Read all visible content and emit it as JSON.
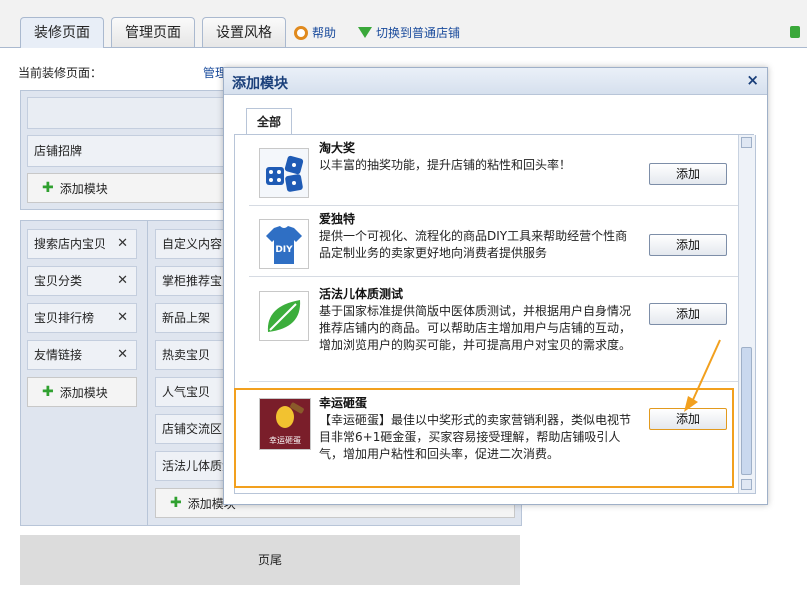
{
  "tabs": [
    {
      "label": "装修页面"
    },
    {
      "label": "管理页面"
    },
    {
      "label": "设置风格"
    }
  ],
  "toplinks": {
    "help": "帮助",
    "switch": "切换到普通店铺"
  },
  "current_page": {
    "label": "当前装修页面：",
    "link": "管理页面"
  },
  "header_section": {
    "row": "店铺招牌",
    "add": "添加模块"
  },
  "left_column": {
    "items": [
      "搜索店内宝贝",
      "宝贝分类",
      "宝贝排行榜",
      "友情链接"
    ],
    "add": "添加模块"
  },
  "mid_column": {
    "items": [
      "自定义内容区",
      "掌柜推荐宝贝",
      "新品上架",
      "热卖宝贝",
      "人气宝贝",
      "店铺交流区",
      "活法儿体质测试"
    ],
    "add": "添加模块"
  },
  "footer": {
    "label": "页尾"
  },
  "modal": {
    "title": "添加模块",
    "close": "×",
    "tab": "全部",
    "items": [
      {
        "name": "淘大奖",
        "desc": "以丰富的抽奖功能，提升店铺的粘性和回头率！",
        "button": "添加",
        "icon": "dice-icon"
      },
      {
        "name": "爱独特",
        "desc": "提供一个可视化、流程化的商品DIY工具来帮助经营个性商品定制业务的卖家更好地向消费者提供服务",
        "button": "添加",
        "icon": "diy-shirt-icon",
        "badge": "DIY"
      },
      {
        "name": "活法儿体质测试",
        "desc": "基于国家标准提供简版中医体质测试，并根据用户自身情况推荐店铺内的商品。可以帮助店主增加用户与店铺的互动，增加浏览用户的购买可能，并可提高用户对宝贝的需求度。",
        "button": "添加",
        "icon": "leaf-icon"
      },
      {
        "name": "幸运砸蛋",
        "desc": "【幸运砸蛋】最佳以中奖形式的卖家营销利器，类似电视节目非常6+1砸金蛋，买家容易接受理解，帮助店铺吸引人气，增加用户粘性和回头率，促进二次消费。",
        "button": "添加",
        "icon": "golden-egg-icon",
        "badge": "幸运砸蛋"
      }
    ]
  }
}
